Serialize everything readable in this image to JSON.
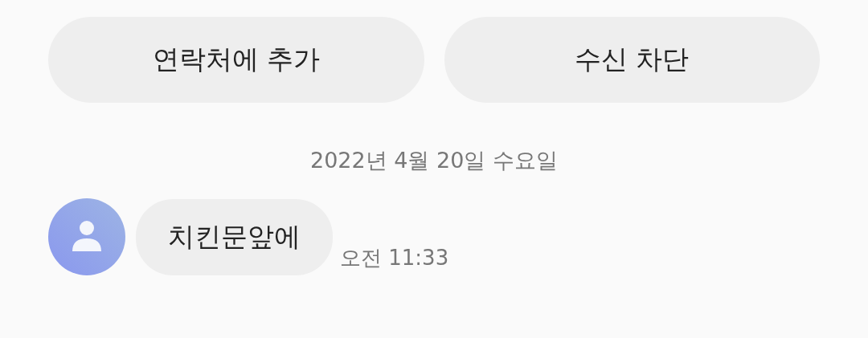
{
  "actions": [
    {
      "label": "연락처에 추가"
    },
    {
      "label": "수신 차단"
    }
  ],
  "date": "2022년 4월 20일 수요일",
  "messages": [
    {
      "text": "치킨문앞에",
      "time": "오전 11:33"
    }
  ]
}
